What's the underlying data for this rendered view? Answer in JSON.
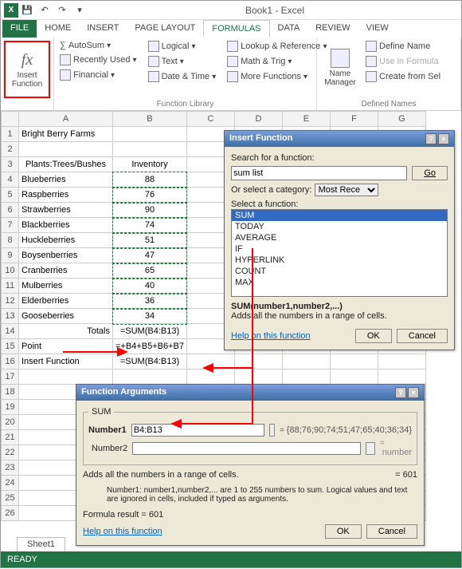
{
  "titlebar": {
    "title": "Book1 - Excel"
  },
  "tabs": {
    "file": "FILE",
    "home": "HOME",
    "insert": "INSERT",
    "page": "PAGE LAYOUT",
    "formulas": "FORMULAS",
    "data": "DATA",
    "review": "REVIEW",
    "view": "VIEW"
  },
  "ribbon": {
    "insert_function": "Insert\nFunction",
    "autosum": "AutoSum",
    "recent": "Recently Used",
    "financial": "Financial",
    "logical": "Logical",
    "text": "Text",
    "datetime": "Date & Time",
    "lookup": "Lookup & Reference",
    "math": "Math & Trig",
    "more": "More Functions",
    "library_caption": "Function Library",
    "name_manager": "Name\nManager",
    "define": "Define Name",
    "usein": "Use in Formula",
    "create": "Create from Sel",
    "names_caption": "Defined Names"
  },
  "grid": {
    "cols": [
      "A",
      "B",
      "C",
      "D",
      "E",
      "F",
      "G"
    ],
    "rows": [
      {
        "n": 1,
        "a": "Bright Berry Farms",
        "b": ""
      },
      {
        "n": 2,
        "a": "",
        "b": ""
      },
      {
        "n": 3,
        "a": "Plants:Trees/Bushes",
        "b": "Inventory"
      },
      {
        "n": 4,
        "a": "Blueberries",
        "b": "88"
      },
      {
        "n": 5,
        "a": "Raspberries",
        "b": "76"
      },
      {
        "n": 6,
        "a": "Strawberries",
        "b": "90"
      },
      {
        "n": 7,
        "a": "Blackberries",
        "b": "74"
      },
      {
        "n": 8,
        "a": "Huckleberries",
        "b": "51"
      },
      {
        "n": 9,
        "a": "Boysenberries",
        "b": "47"
      },
      {
        "n": 10,
        "a": "Cranberries",
        "b": "65"
      },
      {
        "n": 11,
        "a": "Mulberries",
        "b": "40"
      },
      {
        "n": 12,
        "a": "Elderberries",
        "b": "36"
      },
      {
        "n": 13,
        "a": "Gooseberries",
        "b": "34"
      },
      {
        "n": 14,
        "a": "Totals",
        "b": "=SUM(B4:B13)"
      },
      {
        "n": 15,
        "a": "Point",
        "b": "=+B4+B5+B6+B7"
      },
      {
        "n": 16,
        "a": "Insert Function",
        "b": "=SUM(B4:B13)"
      }
    ],
    "extra_rows": [
      17,
      18,
      19,
      20,
      21,
      22,
      23,
      24,
      25,
      26
    ],
    "sheet": "Sheet1"
  },
  "insert_dlg": {
    "title": "Insert Function",
    "search_label": "Search for a function:",
    "search_value": "sum list",
    "go": "Go",
    "cat_label": "Or select a category:",
    "cat_value": "Most Recently Used",
    "sel_label": "Select a function:",
    "functions": [
      "SUM",
      "TODAY",
      "AVERAGE",
      "IF",
      "HYPERLINK",
      "COUNT",
      "MAX"
    ],
    "sig": "SUM(number1,number2,...)",
    "desc": "Adds all the numbers in a range of cells.",
    "help": "Help on this function",
    "ok": "OK",
    "cancel": "Cancel"
  },
  "args_dlg": {
    "title": "Function Arguments",
    "fn": "SUM",
    "num1_label": "Number1",
    "num1_value": "B4:B13",
    "num1_preview": "{88;76;90;74;51;47;65;40;36;34}",
    "num2_label": "Number2",
    "num2_hint": "number",
    "desc": "Adds all the numbers in a range of cells.",
    "result_inline": "=   601",
    "arg_help": "Number1:  number1,number2,... are 1 to 255 numbers to sum. Logical values and text are ignored in cells, included if typed as arguments.",
    "formula_result": "Formula result =   601",
    "help": "Help on this function",
    "ok": "OK",
    "cancel": "Cancel"
  },
  "status": {
    "ready": "READY"
  }
}
